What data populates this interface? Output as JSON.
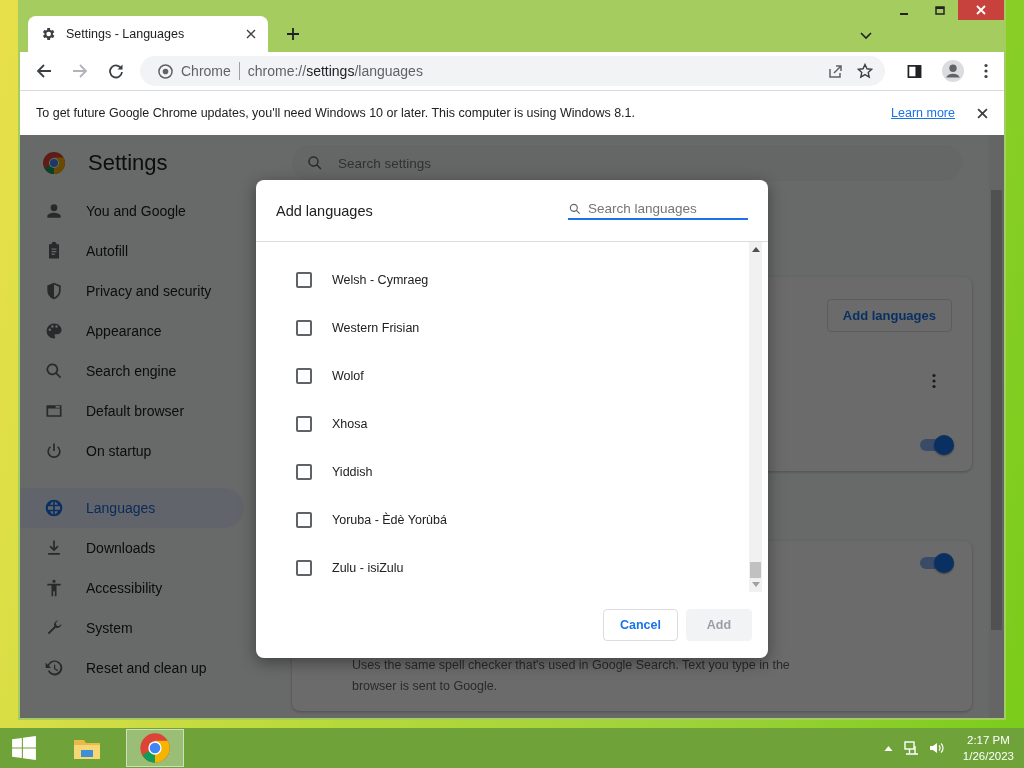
{
  "browser": {
    "tab": {
      "title": "Settings - Languages"
    },
    "site_chip": "Chrome",
    "url_prefix": "chrome://",
    "url_path": "settings",
    "url_rest": "/languages",
    "infobar": {
      "message": "To get future Google Chrome updates, you'll need Windows 10 or later. This computer is using Windows 8.1.",
      "link": "Learn more"
    }
  },
  "settings": {
    "title": "Settings",
    "search": {
      "placeholder": "Search settings"
    },
    "sidebar": {
      "items": [
        {
          "label": "You and Google",
          "selected": false
        },
        {
          "label": "Autofill",
          "selected": false
        },
        {
          "label": "Privacy and security",
          "selected": false
        },
        {
          "label": "Appearance",
          "selected": false
        },
        {
          "label": "Search engine",
          "selected": false
        },
        {
          "label": "Default browser",
          "selected": false
        },
        {
          "label": "On startup",
          "selected": false
        },
        {
          "label": "Languages",
          "selected": true
        },
        {
          "label": "Downloads",
          "selected": false
        },
        {
          "label": "Accessibility",
          "selected": false
        },
        {
          "label": "System",
          "selected": false
        },
        {
          "label": "Reset and clean up",
          "selected": false
        }
      ]
    },
    "languages_card": {
      "add_button": "Add languages",
      "toggle": {
        "on": true
      }
    },
    "spell_card": {
      "toggle": {
        "on": true
      },
      "description": "Uses the same spell checker that's used in Google Search. Text you type in the browser is sent to Google."
    }
  },
  "dialog": {
    "title": "Add languages",
    "search": {
      "placeholder": "Search languages"
    },
    "languages": [
      {
        "label": "Welsh - Cymraeg",
        "checked": false
      },
      {
        "label": "Western Frisian",
        "checked": false
      },
      {
        "label": "Wolof",
        "checked": false
      },
      {
        "label": "Xhosa",
        "checked": false
      },
      {
        "label": "Yiddish",
        "checked": false
      },
      {
        "label": "Yoruba - Èdè Yorùbá",
        "checked": false
      },
      {
        "label": "Zulu - isiZulu",
        "checked": false
      }
    ],
    "buttons": [
      {
        "label": "Cancel",
        "kind": "secondary",
        "disabled": false
      },
      {
        "label": "Add",
        "kind": "primary",
        "disabled": true
      }
    ]
  },
  "taskbar": {
    "time": "2:17 PM",
    "date": "1/26/2023"
  }
}
